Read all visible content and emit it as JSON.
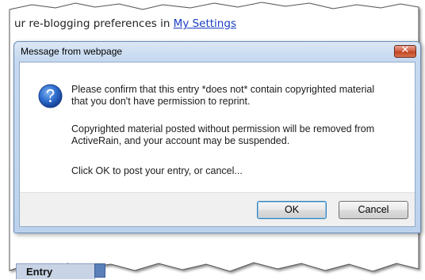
{
  "background": {
    "preference_prefix": "ur re-blogging preferences in ",
    "settings_link": "My Settings",
    "bottom_tab_label": "Entry"
  },
  "dialog": {
    "title": "Message from webpage",
    "close_glyph": "✕",
    "icon": "question-icon",
    "message_line1": "Please confirm that this entry *does not* contain copyrighted material",
    "message_line2": "that you don't have permission to reprint.",
    "message_line3": "Copyrighted material posted without permission will be removed from",
    "message_line4": "ActiveRain, and your account may be suspended.",
    "message_line5": "Click OK to post your entry, or cancel...",
    "ok_label": "OK",
    "cancel_label": "Cancel"
  },
  "colors": {
    "link": "#1a3ec2",
    "dialog_frame": "#c6d9ef",
    "close_button": "#c0431f",
    "icon_blue": "#1f5fbf"
  }
}
